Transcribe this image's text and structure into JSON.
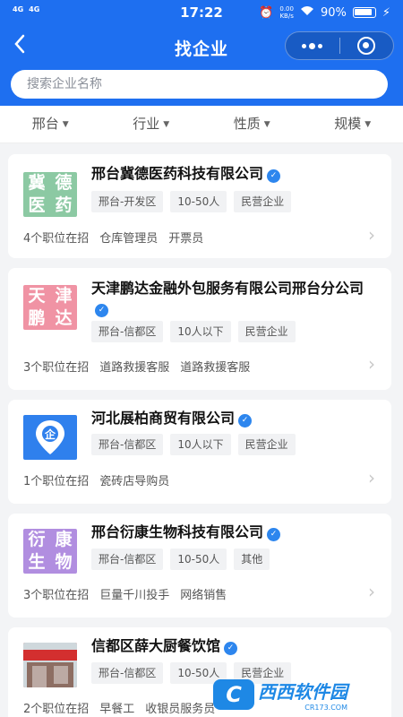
{
  "status": {
    "left": [
      "4G",
      "4G"
    ],
    "time": "17:22",
    "net_speed": "0.00\nKB/s",
    "battery": "90%"
  },
  "nav": {
    "back_icon": "chevron-left",
    "title": "找企业"
  },
  "search": {
    "placeholder": "搜索企业名称"
  },
  "filters": [
    {
      "label": "邢台"
    },
    {
      "label": "行业"
    },
    {
      "label": "性质"
    },
    {
      "label": "规模"
    }
  ],
  "companies": [
    {
      "logo_text": [
        "冀",
        "德",
        "医",
        "药"
      ],
      "name": "邢台冀德医药科技有限公司",
      "tags": [
        "邢台-开发区",
        "10-50人",
        "民营企业"
      ],
      "jobs_count": "4个职位在招",
      "jobs": [
        "仓库管理员",
        "开票员"
      ]
    },
    {
      "logo_text": [
        "天",
        "津",
        "鹏",
        "达"
      ],
      "name": "天津鹏达金融外包服务有限公司邢台分公司",
      "tags": [
        "邢台-信都区",
        "10人以下",
        "民营企业"
      ],
      "jobs_count": "3个职位在招",
      "jobs": [
        "道路救援客服",
        "道路救援客服"
      ]
    },
    {
      "logo_text": [
        "企"
      ],
      "name": "河北展柏商贸有限公司",
      "tags": [
        "邢台-信都区",
        "10人以下",
        "民营企业"
      ],
      "jobs_count": "1个职位在招",
      "jobs": [
        "瓷砖店导购员"
      ]
    },
    {
      "logo_text": [
        "衍",
        "康",
        "生",
        "物"
      ],
      "name": "邢台衍康生物科技有限公司",
      "tags": [
        "邢台-信都区",
        "10-50人",
        "其他"
      ],
      "jobs_count": "3个职位在招",
      "jobs": [
        "巨量千川投手",
        "网络销售"
      ]
    },
    {
      "name": "信都区薛大厨餐饮馆",
      "tags": [
        "邢台-信都区",
        "10-50人",
        "民营企业"
      ],
      "jobs_count": "2个职位在招",
      "jobs": [
        "早餐工",
        "收银员服务员"
      ]
    }
  ],
  "watermark": {
    "brand": "西西软件园",
    "url": "CR173.COM"
  }
}
